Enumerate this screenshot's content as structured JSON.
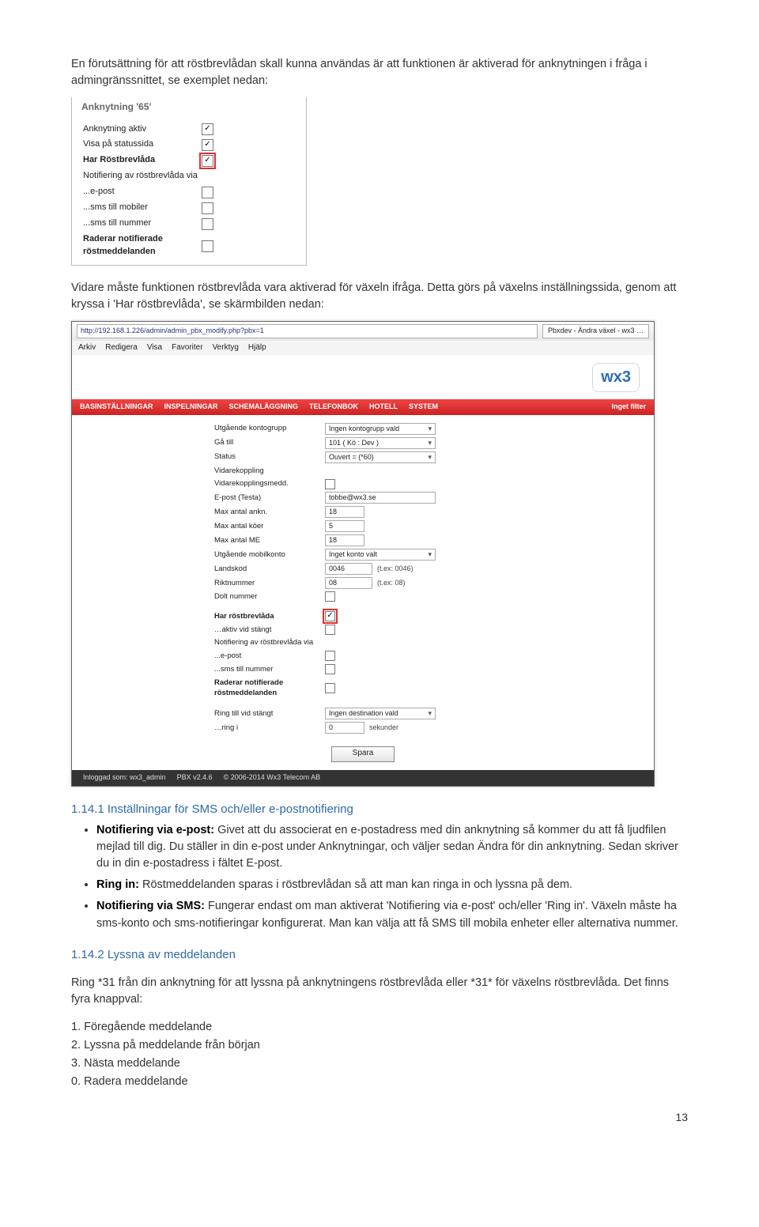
{
  "intro": "En förutsättning för att röstbrevlådan skall kunna användas är att funktionen är aktiverad för anknytningen i fråga i admingränssnittet, se exemplet nedan:",
  "fig1": {
    "legend": "Anknytning '65'",
    "rows": {
      "active": "Anknytning aktiv",
      "status": "Visa på statussida",
      "vm": "Har Röstbrevlåda",
      "notif": "Notifiering av röstbrevlåda via",
      "email": "...e-post",
      "sms_mob": "...sms till mobiler",
      "sms_num": "...sms till nummer",
      "erase": "Raderar notifierade röstmeddelanden"
    }
  },
  "para2": "Vidare måste funktionen röstbrevlåda vara aktiverad för växeln ifråga. Detta görs på växelns inställningssida, genom att kryssa i 'Har röstbrevlåda', se skärmbilden nedan:",
  "fig2": {
    "url": "http://192.168.1.226/admin/admin_pbx_modify.php?pbx=1",
    "tab": "Pbxdev - Ändra växel - wx3 …",
    "menus": [
      "Arkiv",
      "Redigera",
      "Visa",
      "Favoriter",
      "Verktyg",
      "Hjälp"
    ],
    "logo": "wx3",
    "nav": [
      "BASINSTÄLLNINGAR",
      "INSPELNINGAR",
      "SCHEMALÄGGNING",
      "TELEFONBOK",
      "HOTELL",
      "SYSTEM"
    ],
    "nav_right": "Inget filter",
    "form": {
      "out_kontogrupp_l": "Utgående kontogrupp",
      "out_kontogrupp_v": "Ingen kontogrupp vald",
      "ga_till_l": "Gå till",
      "ga_till_v": "101 ( Kö : Dev )",
      "status_l": "Status",
      "status_v": "Ouvert = (*60)",
      "vidarekoppling_l": "Vidarekoppling",
      "vidaremedd_l": "Vidarekopplingsmedd.",
      "epost_l": "E-post (Testa)",
      "epost_v": "tobbe@wx3.se",
      "max_ankn_l": "Max antal ankn.",
      "max_ankn_v": "18",
      "max_koer_l": "Max antal köer",
      "max_koer_v": "5",
      "max_me_l": "Max antal ME",
      "max_me_v": "18",
      "out_mobil_l": "Utgående mobilkonto",
      "out_mobil_v": "Inget konto valt",
      "landskod_l": "Landskod",
      "landskod_v": "0046",
      "landskod_n": "(t.ex: 0046)",
      "riktnr_l": "Riktnummer",
      "riktnr_v": "08",
      "riktnr_n": "(t.ex: 08)",
      "dolt_l": "Dolt nummer",
      "har_vm_l": "Har röstbrevlåda",
      "aktiv_stangt_l": "…aktiv vid stängt",
      "notif_via_l": "Notifiering av röstbrevlåda via",
      "n_epost_l": "...e-post",
      "n_sms_l": "...sms till nummer",
      "raderar_l": "Raderar notifierade röstmeddelanden",
      "ring_l": "Ring till vid stängt",
      "ring_v": "Ingen destination vald",
      "ring_i_l": "…ring i",
      "ring_i_v": "0",
      "ring_i_unit": "sekunder",
      "save": "Spara"
    },
    "footer": {
      "user": "Inloggad som: wx3_admin",
      "pbx": "PBX v2.4.6",
      "copy": "© 2006-2014 Wx3 Telecom AB"
    }
  },
  "sec1": {
    "heading": "1.14.1  Inställningar för SMS och/eller e-postnotifiering",
    "b1_label": "Notifiering via e-post:",
    "b1_text": " Givet att du associerat en e-postadress med din anknytning så kommer du att få ljudfilen mejlad till dig. Du ställer in din e-post under Anknytningar, och väljer sedan Ändra för din anknytning. Sedan skriver du in din e-postadress i fältet E-post.",
    "b2_label": "Ring in:",
    "b2_text": " Röstmeddelanden sparas i röstbrevlådan så att man kan ringa in och lyssna på dem.",
    "b3_label": "Notifiering via SMS:",
    "b3_text": " Fungerar endast om man aktiverat 'Notifiering via e-post' och/eller 'Ring in'. Växeln måste ha sms-konto och sms-notifieringar konfigurerat. Man kan välja att få SMS till mobila enheter eller alternativa nummer."
  },
  "sec2": {
    "heading": "1.14.2  Lyssna av meddelanden",
    "p": "Ring *31 från din anknytning för att lyssna på anknytningens röstbrevlåda eller *31* för växelns röstbrevlåda. Det finns fyra knappval:",
    "items": {
      "i1": "1. Föregående meddelande",
      "i2": "2. Lyssna på meddelande från början",
      "i3": "3. Nästa meddelande",
      "i0": "0. Radera meddelande"
    }
  },
  "page_number": "13"
}
